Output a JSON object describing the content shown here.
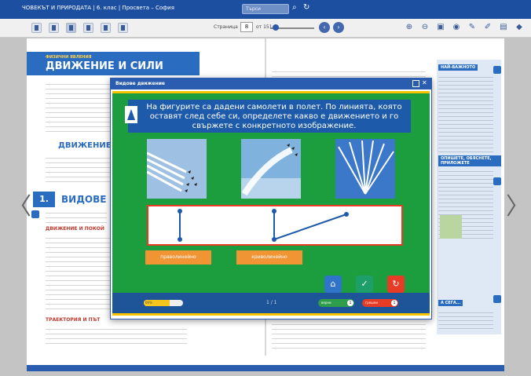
{
  "app": {
    "title": "ЧОВЕКЪТ И ПРИРОДАТА | 6. клас | Просвета – София",
    "search_placeholder": "Търси"
  },
  "toolbar": {
    "page_label": "Страница",
    "current_page": "8",
    "total_pages": "от 151"
  },
  "book": {
    "left_page": {
      "kicker": "ФИЗИЧНИ ЯВЛЕНИЯ",
      "heading": "ДВИЖЕНИЕ И СИЛИ",
      "subheading": "ДВИЖЕНИЕ",
      "chapter_number": "1.",
      "chapter_title": "ВИДОВЕ ДВ",
      "section_motion_rest": "ДВИЖЕНИЕ И ПОКОЙ",
      "section_trajectory": "ТРАЕКТОРИЯ И ПЪТ"
    },
    "right_page": {
      "sidebar_head_1": "НАЙ-ВАЖНОТО",
      "sidebar_head_2": "ОПИШЕТЕ, ОБЯСНЕТЕ, ПРИЛОЖЕТЕ",
      "sidebar_head_3": "А СЕГА..."
    }
  },
  "modal": {
    "title": "Видове движение",
    "question": "На фигурите са дадени самолети в полет. По линията, която оставят след себе си, определете какво е движението и го свържете с конкретното изображение.",
    "options": [
      "праволинейно",
      "криволинейно"
    ],
    "progress_label": "66%",
    "progress": 0.66,
    "counter": "1 / 1",
    "correct_label": "верни",
    "correct_count": "1",
    "wrong_label": "грешни",
    "wrong_count": "1"
  },
  "colors": {
    "brand_blue": "#1c4f9f",
    "activity_green": "#1d9e3e",
    "drop_border": "#e63b25",
    "option_orange": "#f19434"
  }
}
